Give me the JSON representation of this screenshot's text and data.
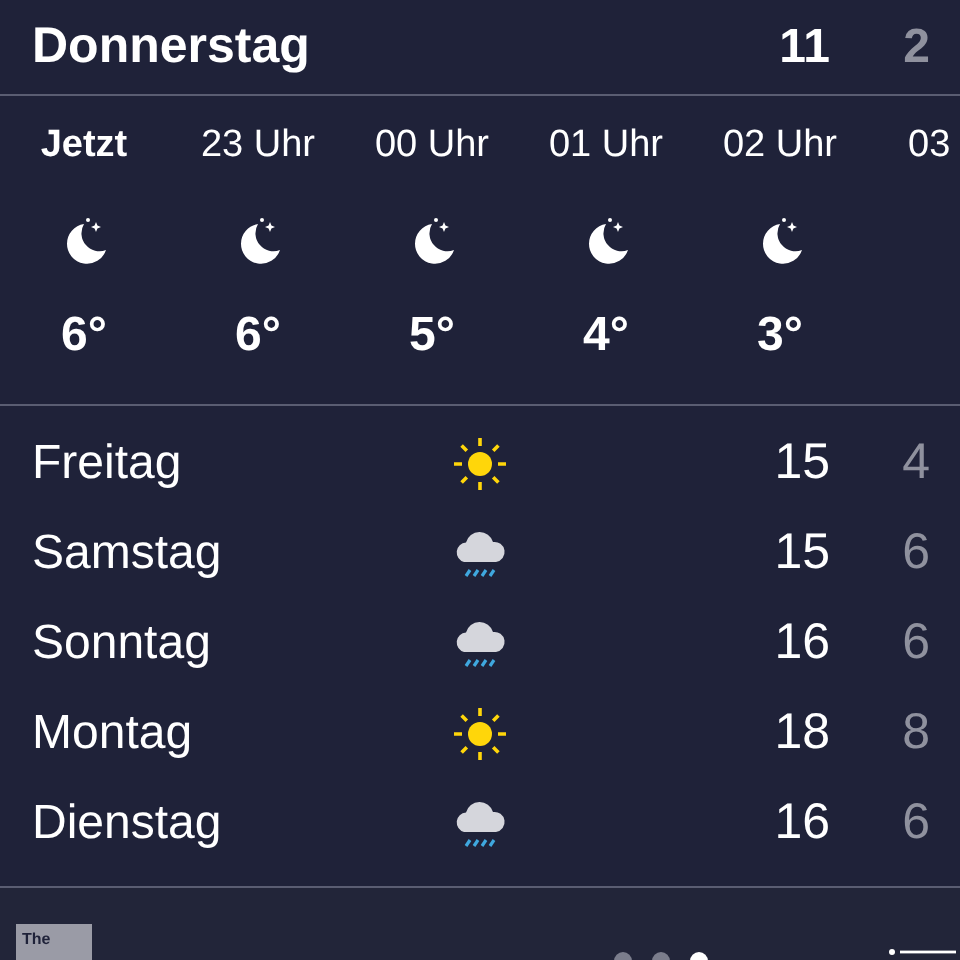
{
  "today": {
    "day": "Donnerstag",
    "high": "11",
    "low": "2"
  },
  "hourly": [
    {
      "time": "Jetzt",
      "current": true,
      "kind": "moon",
      "temp": "6°"
    },
    {
      "time": "23 Uhr",
      "current": false,
      "kind": "moon",
      "temp": "6°"
    },
    {
      "time": "00 Uhr",
      "current": false,
      "kind": "moon",
      "temp": "5°"
    },
    {
      "time": "01 Uhr",
      "current": false,
      "kind": "moon",
      "temp": "4°"
    },
    {
      "time": "02 Uhr",
      "current": false,
      "kind": "moon",
      "temp": "3°"
    },
    {
      "time": "03",
      "current": false
    }
  ],
  "daily": [
    {
      "day": "Freitag",
      "kind": "sun",
      "high": "15",
      "low": "4"
    },
    {
      "day": "Samstag",
      "kind": "rain",
      "high": "15",
      "low": "6"
    },
    {
      "day": "Sonntag",
      "kind": "rain",
      "high": "16",
      "low": "6"
    },
    {
      "day": "Montag",
      "kind": "sun",
      "high": "18",
      "low": "8"
    },
    {
      "day": "Dienstag",
      "kind": "rain",
      "high": "16",
      "low": "6"
    }
  ],
  "bottom_bar": {
    "logo": "The",
    "pages": [
      {
        "selected": false
      },
      {
        "selected": false
      },
      {
        "selected": true
      }
    ]
  }
}
